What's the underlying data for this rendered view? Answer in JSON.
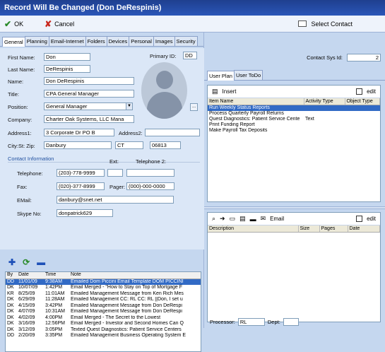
{
  "window": {
    "title": "Record Will Be Changed  (Don DeRespinis)"
  },
  "toolbar": {
    "ok_label": "OK",
    "cancel_label": "Cancel",
    "select_contact_label": "Select Contact"
  },
  "left_tabs": [
    "General",
    "Planning",
    "Email-Internet",
    "Folders",
    "Devices",
    "Personal",
    "Images",
    "Security"
  ],
  "general": {
    "first_name_label": "First Name:",
    "first_name": "Don",
    "last_name_label": "Last Name:",
    "last_name": "DeRespinis",
    "primary_id_label": "Primary ID:",
    "primary_id": "DD",
    "name_label": "Name:",
    "name": "Don DeRespinis",
    "title_label": "Title:",
    "title": "CPA General Manager",
    "position_label": "Position:",
    "position": "General Manager",
    "company_label": "Company:",
    "company": "Charter Oak Systems, LLC Mana",
    "address1_label": "Address1:",
    "address1": "3 Corporate Dr PO B",
    "address2_label": "Address2:",
    "address2": "",
    "citystzip_label": "City:St: Zip:",
    "city": "Danbury",
    "state": "CT",
    "zip": "06813",
    "contact_info_label": "Contact Information",
    "ext_label": "Ext:",
    "telephone2_label": "Telephone 2:",
    "telephone_label": "Telephone:",
    "telephone": "(203)-778-9999",
    "fax_label": "Fax:",
    "fax": "(020)-377-8999",
    "pager_label": "Pager:",
    "pager": "(000)-000-0000",
    "email_label": "EMail:",
    "email": "danbury@snet.net",
    "skype_label": "Skype No:",
    "skype": "donpatrick629",
    "browse_label": "..."
  },
  "history": {
    "headers": [
      "By",
      "Date",
      "Time",
      "Note"
    ],
    "rows": [
      [
        "DD",
        "11/01/09",
        "9:38AM",
        "Emailed Dom Piccini Email Template DOM PICCINI"
      ],
      [
        "DK",
        "10/07/09",
        "1:42PM",
        "Email Merged - \"How to Stay on Top of Mortgage F"
      ],
      [
        "KR",
        "8/25/09",
        "11:01AM",
        "Emailed Management Message from Ken Rich Mes"
      ],
      [
        "DK",
        "6/29/09",
        "11:28AM",
        "Emailed Management  CC: RL CC: RL ||Don, I set u"
      ],
      [
        "DK",
        "4/15/09",
        "3:42PM",
        "Emailed Management Message from Don DeRespi"
      ],
      [
        "DK",
        "4/07/09",
        "10:31AM",
        "Emailed Management Message from Don DeRespi"
      ],
      [
        "DK",
        "4/02/09",
        "4:00PM",
        "Email Merged - The Secret to the Lowest"
      ],
      [
        "DK",
        "3/16/09",
        "12:56PM",
        "Email Merged - Investor and Second Homes Can Q"
      ],
      [
        "DK",
        "3/12/09",
        "3:05PM",
        "Texted Quest Diagnostics: Patient Service Centers"
      ],
      [
        "DD",
        "2/20/09",
        "3:35PM",
        "Emailed Management Business Operating System E"
      ]
    ]
  },
  "right": {
    "contact_sys_id_label": "Contact Sys Id:",
    "contact_sys_id": "2",
    "tabs": [
      "User Plan",
      "User ToDo"
    ],
    "insert_label": "Insert",
    "edit_label": "edit",
    "plan_headers": [
      "Item Name",
      "Activity Type",
      "Object Type"
    ],
    "plan_rows": [
      [
        "Run Weekly Status Reports",
        "",
        ""
      ],
      [
        "Process Quarterly Payroll Returns",
        "",
        ""
      ],
      [
        "Quest Diagnostics: Patient Service Cente",
        "Text",
        ""
      ],
      [
        "Print Funding Report",
        "",
        ""
      ],
      [
        "Make Payroll Tax Deposits",
        "",
        ""
      ]
    ],
    "email_label": "Email",
    "edit2_label": "edit",
    "att_headers": [
      "Description",
      "Size",
      "Pages",
      "Date"
    ],
    "processor_label": "Processor:",
    "processor": "RL",
    "dept_label": "Dept:",
    "dept": ""
  }
}
